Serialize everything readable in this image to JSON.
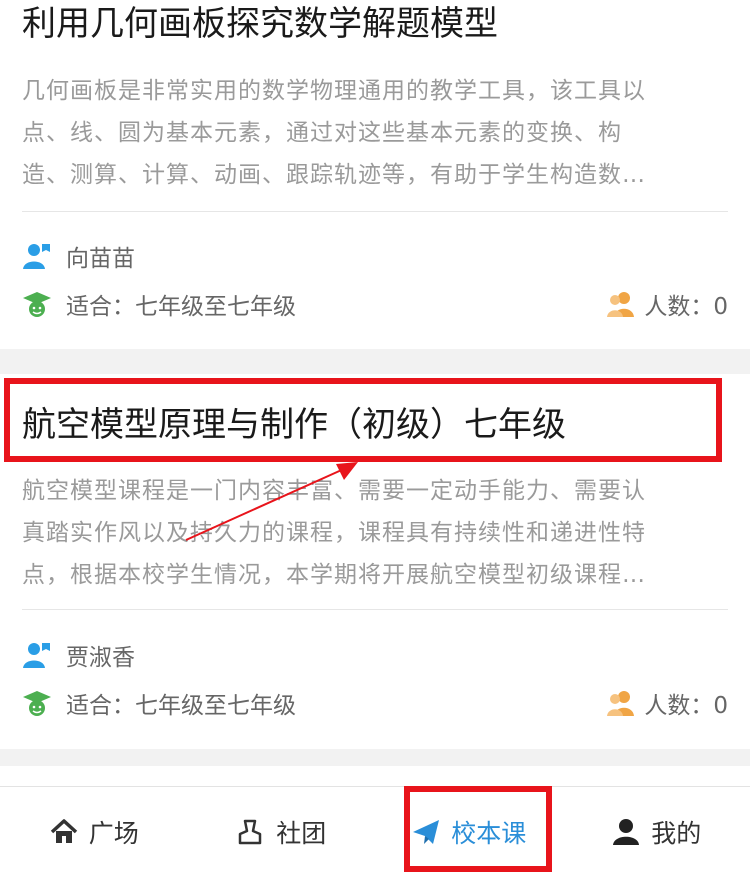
{
  "courses": [
    {
      "title": "利用几何画板探究数学解题模型",
      "desc_lines": [
        "几何画板是非常实用的数学物理通用的教学工具，该工具以",
        "点、线、圆为基本元素，通过对这些基本元素的变换、构",
        "造、测算、计算、动画、跟踪轨迹等，有助于学生构造数…"
      ],
      "teacher": "向苗苗",
      "suitable": "适合：七年级至七年级",
      "count": "人数：0"
    },
    {
      "title": "航空模型原理与制作（初级）七年级",
      "desc_lines": [
        "航空模型课程是一门内容丰富、需要一定动手能力、需要认",
        "真踏实作风以及持久力的课程，课程具有持续性和递进性特",
        "点，根据本校学生情况，本学期将开展航空模型初级课程…"
      ],
      "teacher": "贾淑香",
      "suitable": "适合：七年级至七年级",
      "count": "人数：0"
    }
  ],
  "tabbar": {
    "tabs": [
      {
        "label": "广场",
        "icon": "home-icon"
      },
      {
        "label": "社团",
        "icon": "club-icon"
      },
      {
        "label": "校本课",
        "icon": "paper-plane-icon"
      },
      {
        "label": "我的",
        "icon": "user-icon"
      }
    ],
    "active_index": 2
  },
  "colors": {
    "accent": "#2a8ed8",
    "annotation": "#e8141b",
    "teacher_icon": "#2a9ee6",
    "grade_icon": "#4caf50",
    "count_icon": "#f0a545"
  }
}
